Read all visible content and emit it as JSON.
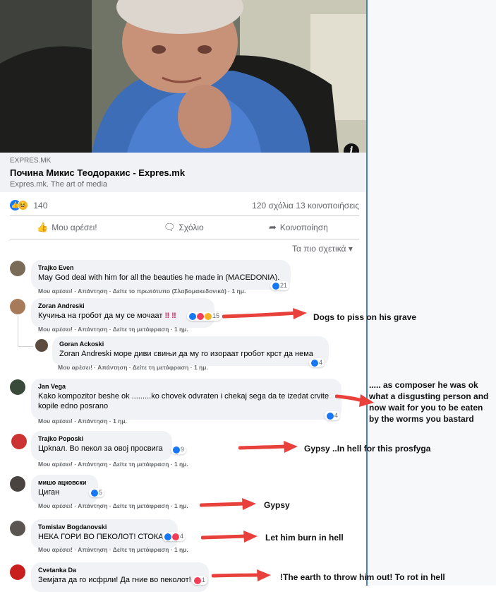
{
  "post": {
    "link": {
      "domain": "EXPRES.MK",
      "title": "Почина Микис Теодоракис - Expres.mk",
      "description": "Expres.mk. The art of media"
    },
    "reaction_count": "140",
    "comments_shares": "120 σχόλια  13 κοινοποιήσεις",
    "actions": {
      "like": "Μου αρέσει!",
      "comment": "Σχόλιο",
      "share": "Κοινοποίηση"
    },
    "sort_label": "Τα πιο σχετικά"
  },
  "comments": [
    {
      "name": "Trajko Even",
      "text": "May God deal with him for all the beauties he made in (MACEDONIA).",
      "meta": "Μου αρέσει! · Απάντηση · Δείτε το πρωτότυπο (Σλαβομακεδονικά) · 1 ημ.",
      "reactions": "21"
    },
    {
      "name": "Zoran Andreski",
      "text": "Кучиња на гробот да му се мочаат",
      "emphasis": "‼ ‼",
      "meta": "Μου αρέσει! · Απάντηση · Δείτε τη μετάφραση · 1 ημ.",
      "reactions": "15"
    },
    {
      "name": "Goran Ackoski",
      "text": "Zoran Andreski море диви свињи да му го изораат гробот крст да нема",
      "meta": "Μου αρέσει! · Απάντηση · Δείτε τη μετάφραση · 1 ημ.",
      "reactions": "4"
    },
    {
      "name": "Jan Vega",
      "text_line1": "Kako kompozitor beshe ok .........ko chovek odvraten i chekaj sega da te izedat crvite",
      "text_line2": "kopile edno posrano",
      "meta": "Μου αρέσει! · Απάντηση · 1 ημ.",
      "reactions": "4"
    },
    {
      "name": "Trajko Poposki",
      "text": "Црknал. Во пекол за овој просвига",
      "meta": "Μου αρέσει! · Απάντηση · Δείτε τη μετάφραση · 1 ημ.",
      "reactions": "9"
    },
    {
      "name": "мишо ацковски",
      "text": "Циган",
      "meta": "Μου αρέσει! · Απάντηση · Δείτε τη μετάφραση · 1 ημ.",
      "reactions": "5"
    },
    {
      "name": "Tomislav Bogdanovski",
      "text": "НЕКА ГОРИ ВО ПЕКОЛОТ! СТОКА!",
      "meta": "Μου αρέσει! · Απάντηση · Δείτε τη μετάφραση · 1 ημ.",
      "reactions": "4"
    },
    {
      "name": "Cvetanka Da",
      "text": "Земјата да го исфрли! Да гние во пеколот!",
      "reactions": "1"
    }
  ],
  "annotations": [
    "Dogs to piss on his grave",
    "..... as composer he was ok what a disgusting person and now wait for you to be eaten by the worms you bastard",
    "Gypsy ..In hell for this prosfyga",
    "Gypsy",
    "Let him burn in hell",
    "!The earth to throw him out! To rot in hell"
  ],
  "colors": {
    "accent": "#1877f2",
    "arrow": "#e8413c",
    "bubble": "#f0f2f5",
    "muted": "#65676b"
  }
}
